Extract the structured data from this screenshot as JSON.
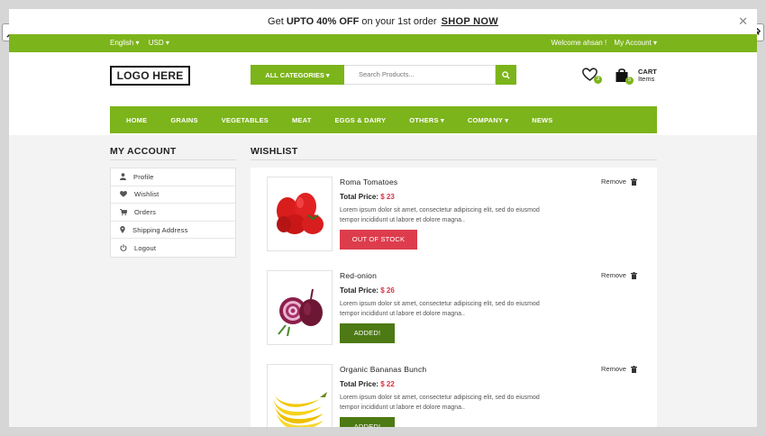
{
  "promo": {
    "prefix": "Get ",
    "bold": "UPTO 40% OFF",
    "middle": " on your 1st order ",
    "link": "SHOP NOW",
    "close": "✕"
  },
  "topbar": {
    "language": "English ▾",
    "currency": "USD ▾",
    "welcome": "Welcome ahsan !",
    "account": "My Account ▾"
  },
  "header": {
    "logo": "LOGO HERE",
    "category_button": "ALL CATEGORIES ▾",
    "search_placeholder": "Search Products...",
    "wishlist_count": "3",
    "cart_count": "5",
    "cart_label": "CART",
    "cart_sub": "Items"
  },
  "nav": [
    {
      "label": "HOME"
    },
    {
      "label": "GRAINS"
    },
    {
      "label": "VEGETABLES"
    },
    {
      "label": "MEAT"
    },
    {
      "label": "EGGS & DAIRY"
    },
    {
      "label": "OTHERS ▾"
    },
    {
      "label": "COMPANY ▾"
    },
    {
      "label": "NEWS"
    }
  ],
  "account": {
    "title": "MY ACCOUNT",
    "items": [
      {
        "label": "Profile",
        "icon": "user-icon"
      },
      {
        "label": "Wishlist",
        "icon": "heart-icon"
      },
      {
        "label": "Orders",
        "icon": "cart-icon"
      },
      {
        "label": "Shipping Address",
        "icon": "map-pin-icon"
      },
      {
        "label": "Logout",
        "icon": "power-icon"
      }
    ]
  },
  "wishlist": {
    "title": "WISHLIST",
    "total_label": "Total Price:",
    "remove_label": "Remove",
    "items": [
      {
        "name": "Roma Tomatoes",
        "price": "$ 23",
        "desc": "Lorem ipsum dolor sit amet, consectetur adipiscing elit, sed do eiusmod tempor incididunt ut labore et dolore magna..",
        "button": "OUT OF STOCK"
      },
      {
        "name": "Red-onion",
        "price": "$ 26",
        "desc": "Lorem ipsum dolor sit amet, consectetur adipiscing elit, sed do eiusmod tempor incididunt ut labore et dolore magna..",
        "button": "ADDED!"
      },
      {
        "name": "Organic Bananas Bunch",
        "price": "$ 22",
        "desc": "Lorem ipsum dolor sit amet, consectetur adipiscing elit, sed do eiusmod tempor incididunt ut labore et dolore magna..",
        "button": "ADDED!"
      }
    ]
  },
  "colors": {
    "brand_green": "#7cb41b",
    "dark_green": "#4d7a14",
    "price_red": "#d63447",
    "out_of_stock": "#dd3c4c"
  }
}
